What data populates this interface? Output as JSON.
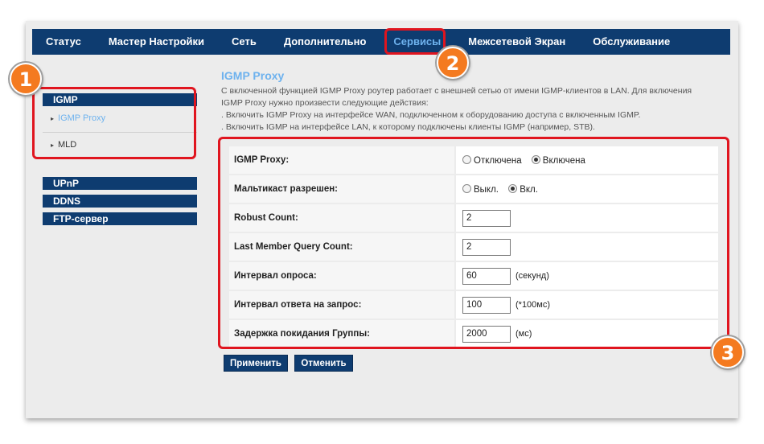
{
  "topnav": {
    "items": [
      {
        "label": "Статус"
      },
      {
        "label": "Мастер Настройки"
      },
      {
        "label": "Сеть"
      },
      {
        "label": "Дополнительно"
      },
      {
        "label": "Сервисы"
      },
      {
        "label": "Межсетевой Экран"
      },
      {
        "label": "Обслуживание"
      }
    ],
    "active_color": "#6eb2ee",
    "bar_color": "#0e3c70"
  },
  "sidebar": {
    "igmp_header": "IGMP",
    "igmp_items": [
      {
        "label": "IGMP Proxy"
      },
      {
        "label": "MLD"
      }
    ],
    "other_sections": [
      {
        "label": "UPnP"
      },
      {
        "label": "DDNS"
      },
      {
        "label": "FTP-сервер"
      }
    ]
  },
  "content": {
    "title": "IGMP Proxy",
    "description": [
      "С включенной функцией IGMP Proxy роутер работает с внешней сетью от имени IGMP-клиентов в LAN. Для включения",
      "IGMP Proxy нужно произвести следующие действия:",
      ". Включить IGMP Proxy на интерфейсе WAN, подключенном к оборудованию доступа с включенным IGMP.",
      ". Включить IGMP на интерфейсе LAN, к которому подключены клиенты IGMP (например, STB)."
    ]
  },
  "settings": {
    "igmp_proxy": {
      "label": "IGMP Proxy:",
      "option_off": "Отключена",
      "option_on": "Включена",
      "selected": "Включена"
    },
    "multicast": {
      "label": "Мальтикаст разрешен:",
      "option_off": "Выкл.",
      "option_on": "Вкл.",
      "selected": "Вкл."
    },
    "robust_count": {
      "label": "Robust Count:",
      "value": "2"
    },
    "last_member_query_count": {
      "label": "Last Member Query Count:",
      "value": "2"
    },
    "query_interval": {
      "label": "Интервал опроса:",
      "value": "60",
      "unit": "(секунд)"
    },
    "query_response_interval": {
      "label": "Интервал ответа на запрос:",
      "value": "100",
      "unit": "(*100мс)"
    },
    "group_leave_delay": {
      "label": "Задержка покидания Группы:",
      "value": "2000",
      "unit": "(мс)"
    }
  },
  "buttons": {
    "apply": "Применить",
    "cancel": "Отменить"
  },
  "annotations": {
    "badge_1": "1",
    "badge_2": "2",
    "badge_3": "3",
    "highlight_color": "#e0151f",
    "badge_color": "#f47a20"
  }
}
